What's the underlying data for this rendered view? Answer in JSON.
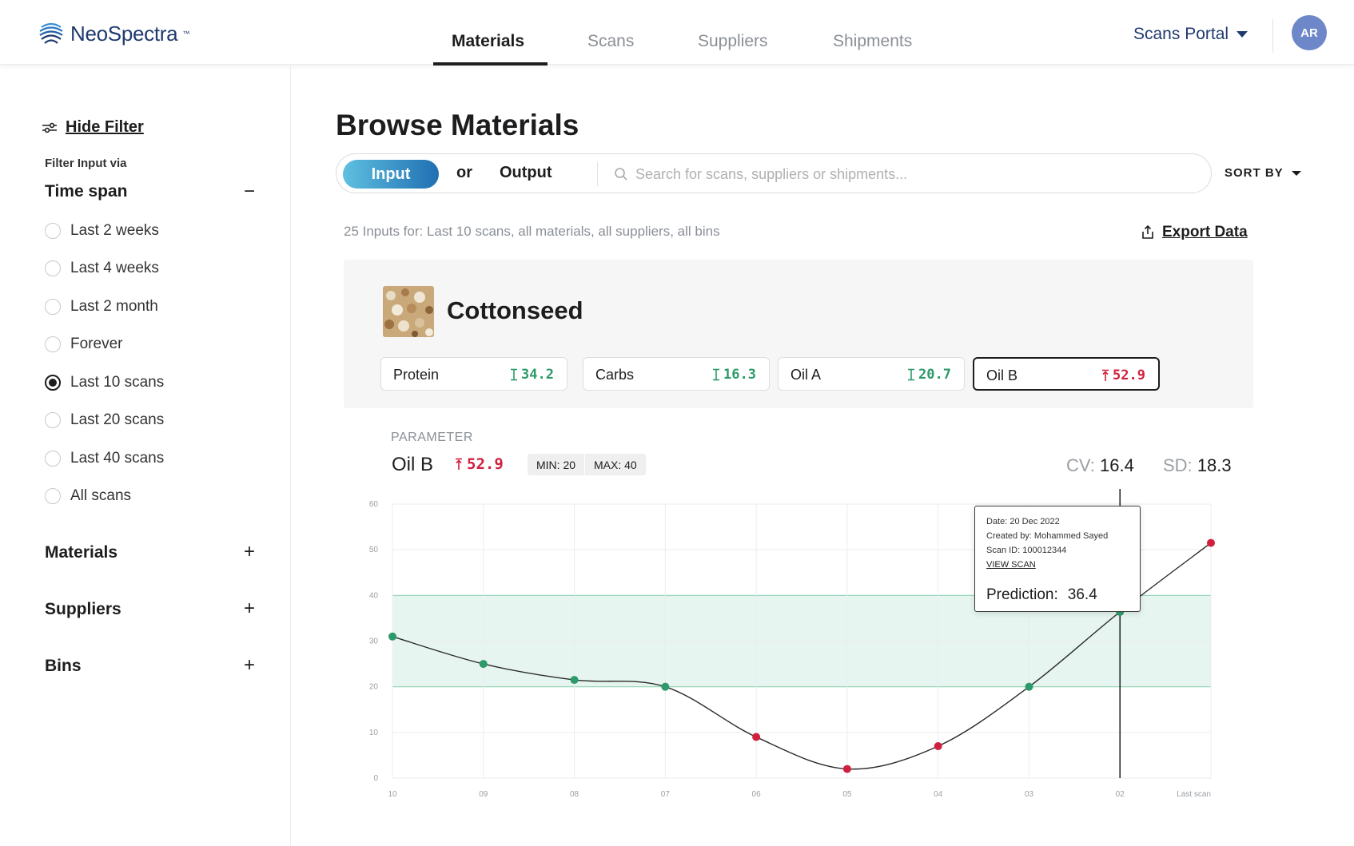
{
  "app": {
    "brand": "NeoSpectra",
    "brand_tm": "™",
    "portal_label": "Scans Portal",
    "avatar_initials": "AR"
  },
  "nav": {
    "tabs": [
      {
        "label": "Materials",
        "active": true
      },
      {
        "label": "Scans",
        "active": false
      },
      {
        "label": "Suppliers",
        "active": false
      },
      {
        "label": "Shipments",
        "active": false
      }
    ]
  },
  "sidebar": {
    "hide_filter": "Hide Filter",
    "filter_via": "Filter Input via",
    "time_span": {
      "title": "Time span",
      "toggle": "−",
      "options": [
        {
          "label": "Last 2 weeks",
          "checked": false
        },
        {
          "label": "Last 4 weeks",
          "checked": false
        },
        {
          "label": "Last 2 month",
          "checked": false
        },
        {
          "label": "Forever",
          "checked": false
        },
        {
          "label": "Last 10 scans",
          "checked": true
        },
        {
          "label": "Last 20 scans",
          "checked": false
        },
        {
          "label": "Last 40 scans",
          "checked": false
        },
        {
          "label": "All scans",
          "checked": false
        }
      ]
    },
    "sections": [
      {
        "title": "Materials",
        "toggle": "+"
      },
      {
        "title": "Suppliers",
        "toggle": "+"
      },
      {
        "title": "Bins",
        "toggle": "+"
      }
    ]
  },
  "main": {
    "title": "Browse Materials",
    "segment": {
      "input": "Input",
      "or": "or",
      "output": "Output"
    },
    "search_placeholder": "Search for scans, suppliers or shipments...",
    "sort_by": "SORT BY",
    "summary": "25 Inputs for: Last 10 scans, all materials, all suppliers, all bins",
    "export": "Export Data",
    "material": {
      "name": "Cottonseed",
      "chips": [
        {
          "label": "Protein",
          "value": "34.2",
          "status": "ok"
        },
        {
          "label": "Carbs",
          "value": "16.3",
          "status": "ok"
        },
        {
          "label": "Oil A",
          "value": "20.7",
          "status": "ok"
        },
        {
          "label": "Oil B",
          "value": "52.9",
          "status": "bad",
          "selected": true
        }
      ]
    },
    "parameter": {
      "label": "PARAMETER",
      "name": "Oil B",
      "value": "52.9",
      "min": "MIN: 20",
      "max": "MAX: 40",
      "cv_label": "CV:",
      "cv_value": "16.4",
      "sd_label": "SD:",
      "sd_value": "18.3"
    },
    "tooltip": {
      "date": "Date: 20 Dec 2022",
      "created_by": "Created by: Mohammed Sayed",
      "scan_id": "Scan ID: 100012344",
      "view_scan": "VIEW SCAN",
      "prediction_label": "Prediction:",
      "prediction_value": "36.4"
    }
  },
  "colors": {
    "accent_navy": "#1f3a6e",
    "in_range": "#2d9a6a",
    "out_of_range": "#d1203f",
    "band": "#e6f5ef",
    "input_gradient_start": "#5fc0e0",
    "input_gradient_end": "#1f6fb2"
  },
  "chart_data": {
    "type": "line",
    "categories": [
      "10",
      "09",
      "08",
      "07",
      "06",
      "05",
      "04",
      "03",
      "02",
      "Last scan"
    ],
    "values": [
      31,
      25,
      21.5,
      20,
      9,
      2,
      7,
      20,
      36.4,
      51.5
    ],
    "status": [
      "ok",
      "ok",
      "ok",
      "ok",
      "bad",
      "bad",
      "bad",
      "ok",
      "ok",
      "bad"
    ],
    "ylim": [
      0,
      60
    ],
    "yticks": [
      "0",
      "10",
      "20",
      "30",
      "40",
      "50",
      "60"
    ],
    "band": [
      20,
      40
    ],
    "highlight_index": 8,
    "grid": true,
    "title": "",
    "xlabel": "",
    "ylabel": ""
  }
}
